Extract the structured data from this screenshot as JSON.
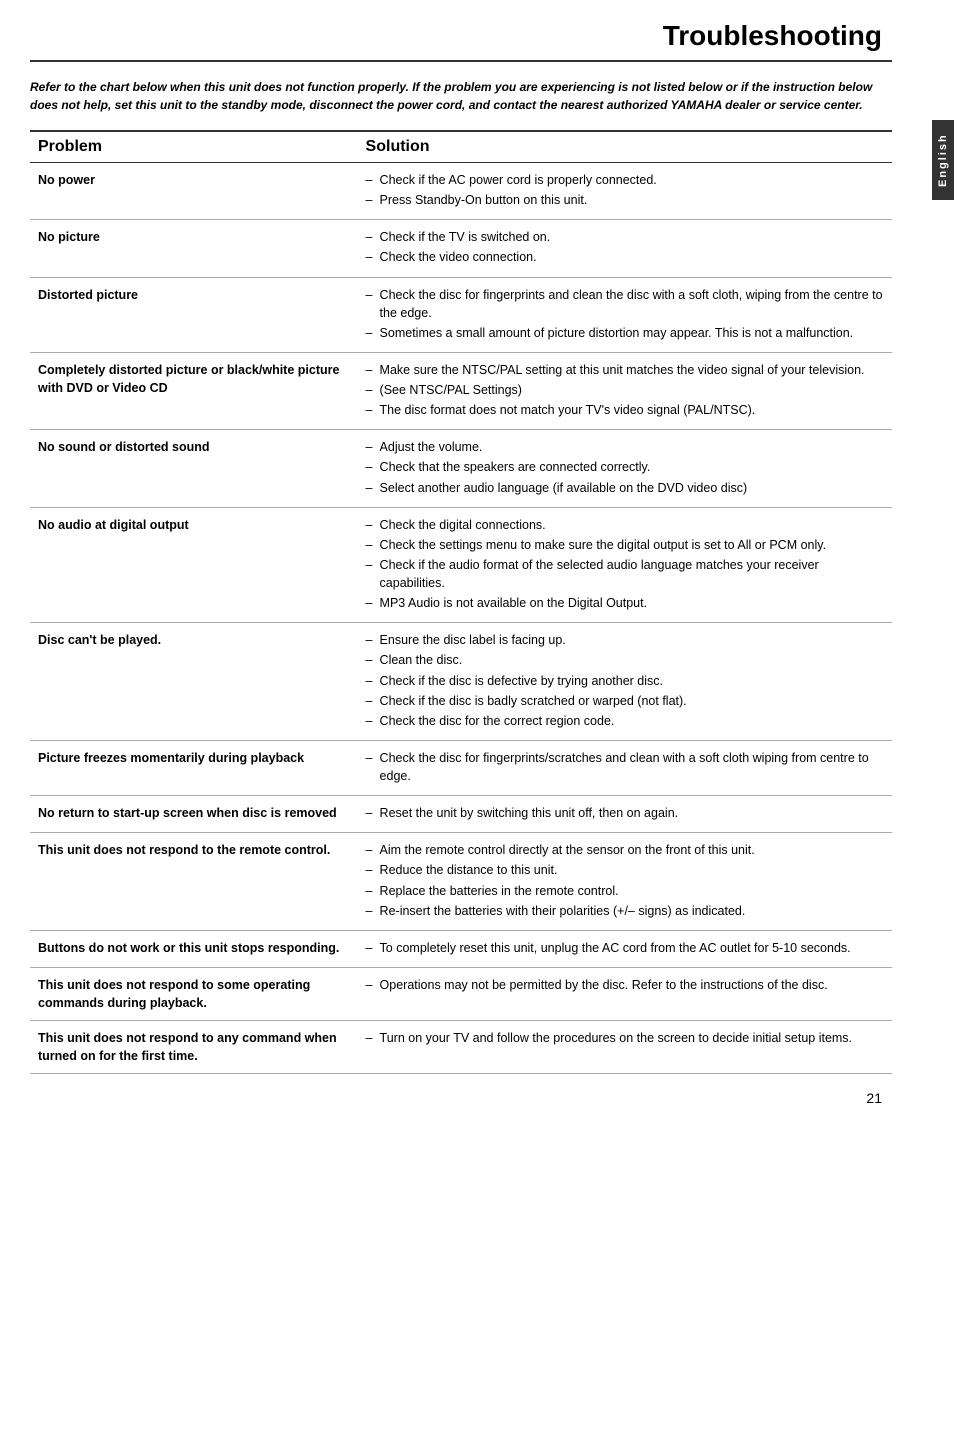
{
  "page": {
    "title": "Troubleshooting",
    "page_number": "21",
    "tab_label": "English",
    "intro": "Refer to the chart below when this unit does not function properly. If the problem you are experiencing is not listed below or if the instruction below does not help, set this unit to the standby mode, disconnect the power cord, and contact the nearest authorized YAMAHA dealer or service center.",
    "table": {
      "col_problem": "Problem",
      "col_solution": "Solution",
      "rows": [
        {
          "problem": "No power",
          "solutions": [
            "Check if the AC power cord is properly connected.",
            "Press Standby-On button on this unit."
          ]
        },
        {
          "problem": "No picture",
          "solutions": [
            "Check if the TV is switched on.",
            "Check the video connection."
          ]
        },
        {
          "problem": "Distorted picture",
          "solutions": [
            "Check the disc for fingerprints and clean the disc with a soft cloth, wiping from the centre to the edge.",
            "Sometimes a small amount of picture distortion may appear. This is not a malfunction."
          ]
        },
        {
          "problem": "Completely distorted picture or black/white picture with DVD or Video CD",
          "solutions": [
            "Make sure the NTSC/PAL setting at this unit matches the video signal of your television.",
            "(See NTSC/PAL Settings)",
            "The disc format does not match your TV's video signal (PAL/NTSC)."
          ]
        },
        {
          "problem": "No sound or distorted sound",
          "solutions": [
            "Adjust the volume.",
            "Check that the speakers are connected correctly.",
            "Select another audio language (if available on the DVD video disc)"
          ]
        },
        {
          "problem": "No audio at digital output",
          "solutions": [
            "Check the digital connections.",
            "Check the settings menu to make sure the digital output is set to All or PCM only.",
            "Check if the audio format of the selected audio language matches your receiver capabilities.",
            "MP3 Audio is not available on the Digital Output."
          ]
        },
        {
          "problem": "Disc can't be played.",
          "solutions": [
            "Ensure the disc label is facing up.",
            "Clean the disc.",
            "Check if the disc is defective by trying another disc.",
            "Check if the disc is badly scratched or warped (not flat).",
            "Check the disc for the correct region code."
          ]
        },
        {
          "problem": "Picture freezes momentarily during playback",
          "solutions": [
            "Check the disc for fingerprints/scratches and clean with a soft cloth wiping from centre to edge."
          ]
        },
        {
          "problem": "No return to start-up screen when disc is removed",
          "solutions": [
            "Reset the unit by switching this unit off, then on again."
          ]
        },
        {
          "problem": "This unit does not respond to the remote control.",
          "solutions": [
            "Aim the remote control directly at the sensor on the front of this unit.",
            "Reduce the distance to this unit.",
            "Replace the batteries in the remote control.",
            "Re-insert the batteries with their polarities (+/– signs) as indicated."
          ]
        },
        {
          "problem": "Buttons do not work or this unit stops responding.",
          "solutions": [
            "To completely reset this unit, unplug the AC cord from the AC outlet for 5-10 seconds."
          ]
        },
        {
          "problem": "This unit does not respond to some operating commands during playback.",
          "solutions": [
            "Operations may not be permitted by the disc. Refer to the instructions of  the disc."
          ]
        },
        {
          "problem": "This unit does not respond to any command when turned on for the first time.",
          "solutions": [
            "Turn on your TV and follow the procedures on the screen to decide initial setup items."
          ]
        }
      ]
    }
  }
}
